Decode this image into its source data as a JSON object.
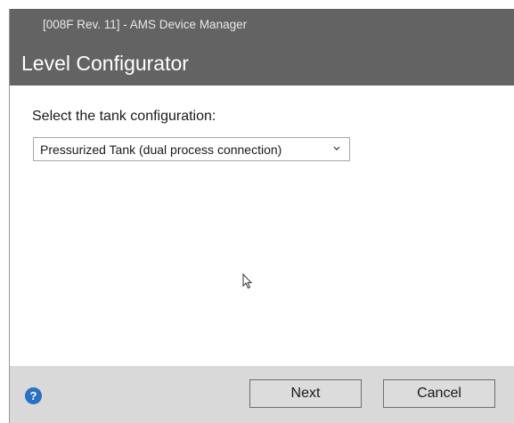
{
  "window": {
    "subtitle": "[008F Rev. 11] - AMS Device Manager",
    "title": "Level Configurator"
  },
  "main": {
    "prompt": "Select the tank configuration:",
    "tank_select": {
      "selected": "Pressurized Tank (dual process connection)"
    }
  },
  "footer": {
    "help_symbol": "?",
    "next_label": "Next",
    "cancel_label": "Cancel"
  },
  "colors": {
    "header_bg": "#636363",
    "footer_bg": "#d9d9d9",
    "help_icon": "#2a70c4"
  },
  "icons": [
    "chevron-down-icon",
    "help-icon",
    "mouse-cursor-icon"
  ]
}
